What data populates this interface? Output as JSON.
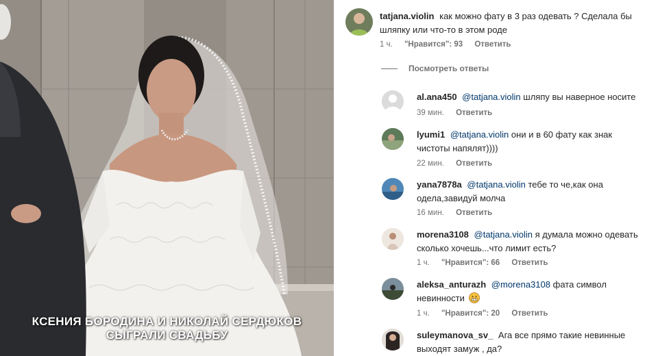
{
  "media": {
    "caption_line1": "КСЕНИЯ БОРОДИНА И НИКОЛАЙ СЕРДЮКОВ",
    "caption_line2": "СЫГРАЛИ СВАДЬБУ"
  },
  "comment": {
    "username": "tatjana.violin",
    "text": "как можно фату в 3 раз одевать ? Сделала бы шляпку или что-то в этом роде",
    "time": "1 ч.",
    "likes": "\"Нравится\": 93",
    "reply_label": "Ответить"
  },
  "view_replies_label": "Посмотреть ответы",
  "replies": [
    {
      "username": "al.ana450",
      "mention": "@tatjana.violin",
      "text": "шляпу вы наверное носите",
      "time": "39 мин.",
      "likes": "",
      "reply_label": "Ответить",
      "avatar": "default-avatar"
    },
    {
      "username": "lyumi1",
      "mention": "@tatjana.violin",
      "text": "они и в 60 фату как знак чистоты напялят))))",
      "time": "22 мин.",
      "likes": "",
      "reply_label": "Ответить",
      "avatar": "photo-avatar"
    },
    {
      "username": "yana7878a",
      "mention": "@tatjana.violin",
      "text": "тебе то че,как она одела,завидуй молча",
      "time": "16 мин.",
      "likes": "",
      "reply_label": "Ответить",
      "avatar": "photo-avatar"
    },
    {
      "username": "morena3108",
      "mention": "@tatjana.violin",
      "text": "я думала можно одевать сколько хочешь...что лимит есть?",
      "time": "1 ч.",
      "likes": "\"Нравится\": 66",
      "reply_label": "Ответить",
      "avatar": "photo-avatar"
    },
    {
      "username": "aleksa_anturazh",
      "mention": "@morena3108",
      "text": "фата символ невинности",
      "time": "1 ч.",
      "likes": "\"Нравится\": 20",
      "reply_label": "Ответить",
      "avatar": "photo-avatar",
      "emoji": "grimacing-face-emoji"
    },
    {
      "username": "suleymanova_sv_",
      "mention": "",
      "text": "Ага все прямо такие невинные выходят замуж , да?",
      "time": "",
      "likes": "",
      "reply_label": "",
      "avatar": "photo-avatar"
    }
  ]
}
